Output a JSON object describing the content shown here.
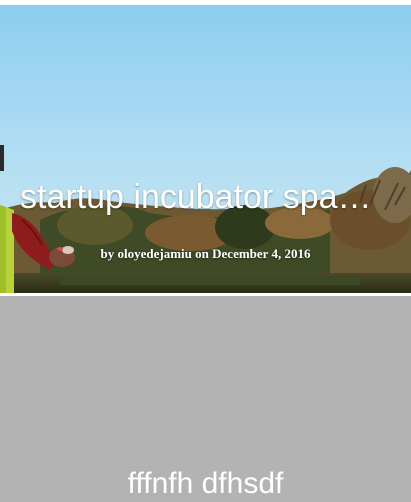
{
  "posts": [
    {
      "title": "startup incubator spa…",
      "meta": {
        "by": "by",
        "author": "oloyedejamiu",
        "on": "on",
        "date": "December 4, 2016"
      }
    },
    {
      "title": "fffnfh dfhsdf"
    }
  ],
  "colors": {
    "sky": "#a9d9f2",
    "card_gray": "#b3b3b3",
    "title_text": "#ffffff"
  }
}
